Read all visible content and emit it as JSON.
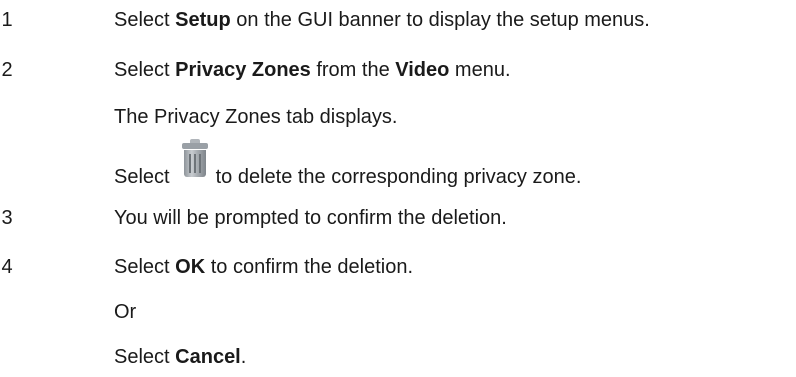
{
  "steps": [
    {
      "number": "1",
      "text_before": "Select ",
      "bold1": "Setup",
      "text_after": " on the GUI banner to display the setup menus."
    },
    {
      "number": "2",
      "text_before": "Select ",
      "bold1": "Privacy Zones",
      "text_middle": " from the ",
      "bold2": "Video",
      "text_after": " menu.",
      "result": "The Privacy Zones tab displays.",
      "select_icon_before": "Select",
      "select_icon_after": "to delete the corresponding privacy zone.",
      "icon": "trash-icon"
    },
    {
      "number": "3",
      "text": "You will be prompted to confirm the deletion."
    },
    {
      "number": "4",
      "text_before": "Select ",
      "bold1": "OK",
      "text_after": " to confirm the deletion.",
      "or": "Or",
      "alt_before": "Select ",
      "alt_bold": "Cancel",
      "alt_after": "."
    }
  ]
}
